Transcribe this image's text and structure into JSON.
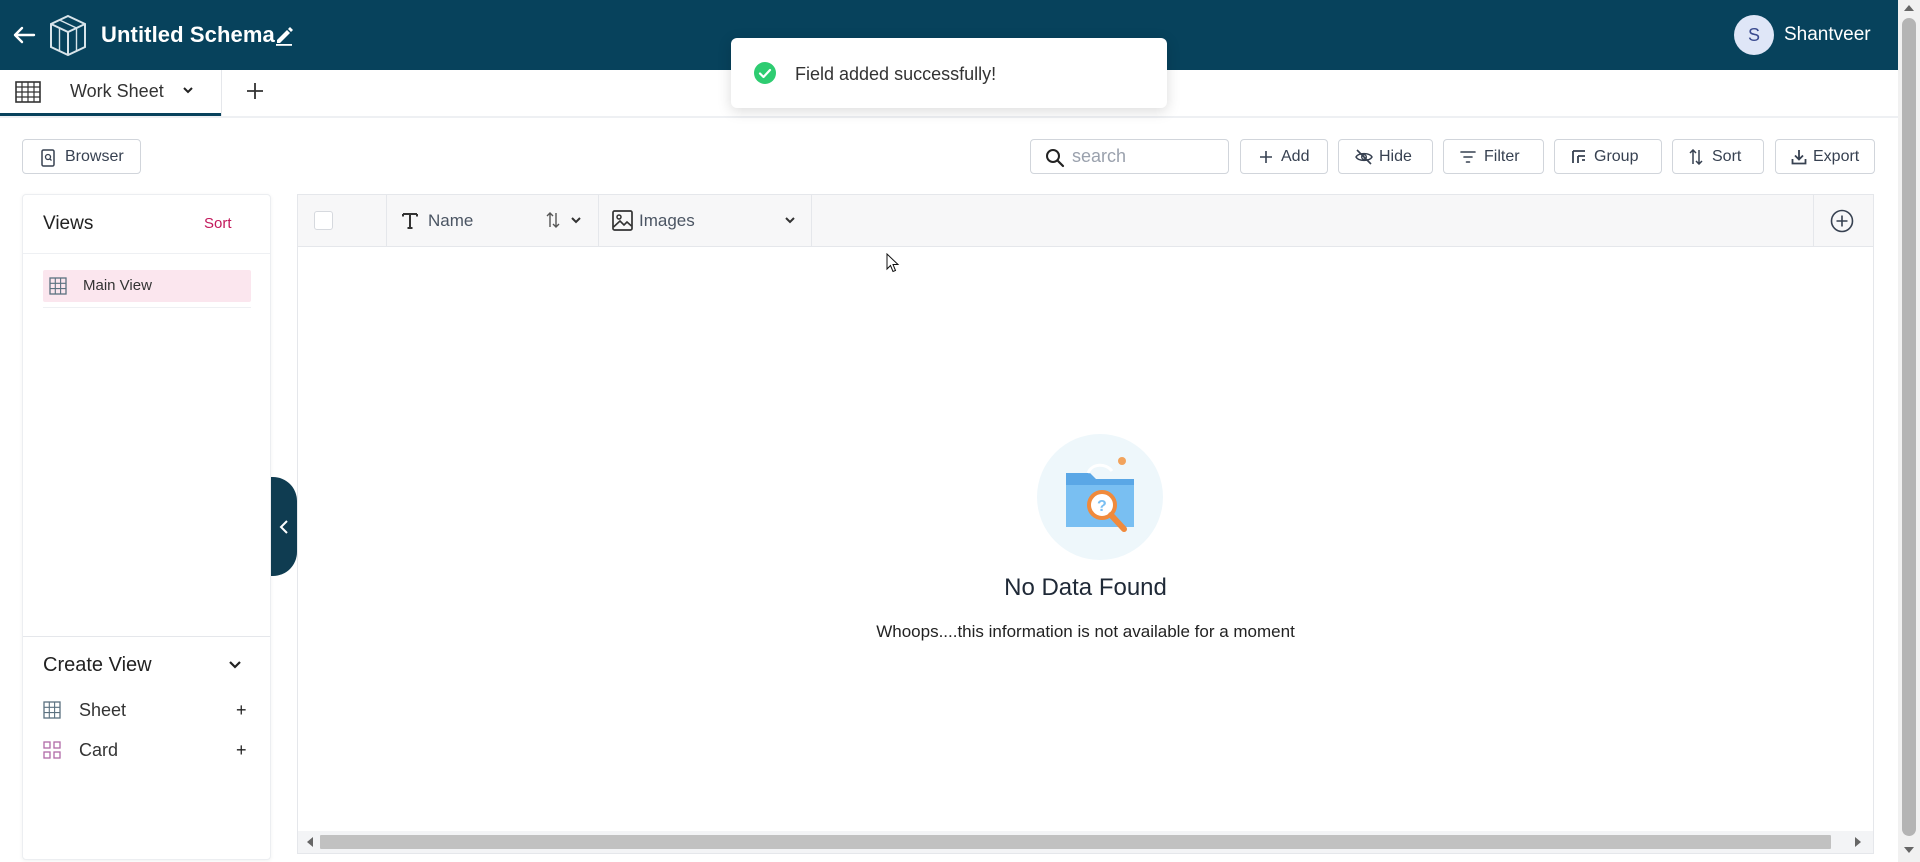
{
  "header": {
    "title": "Untitled Schema",
    "back_icon": "arrow-left-icon",
    "logo_icon": "cube-logo-icon",
    "edit_icon": "pencil-icon",
    "user": {
      "initial": "S",
      "name": "Shantveer"
    },
    "background": "#07425c"
  },
  "toast": {
    "message": "Field added successfully!",
    "icon": "check-circle-icon",
    "icon_color": "#2ecc71"
  },
  "tabs": [
    {
      "label": "Work Sheet",
      "icon": "table-icon",
      "active": true
    }
  ],
  "toolbar": {
    "browser_label": "Browser",
    "search_placeholder": "search",
    "search_value": "",
    "add_label": "Add",
    "hide_label": "Hide",
    "filter_label": "Filter",
    "group_label": "Group",
    "sort_label": "Sort",
    "export_label": "Export"
  },
  "views_panel": {
    "title": "Views",
    "sort_label": "Sort",
    "accent": "#c2185b",
    "items": [
      {
        "label": "Main View",
        "icon": "grid-icon",
        "active": true
      }
    ],
    "create": {
      "title": "Create View",
      "options": [
        {
          "label": "Sheet",
          "icon": "grid-icon",
          "action": "+"
        },
        {
          "label": "Card",
          "icon": "card-icon",
          "action": "+"
        }
      ]
    }
  },
  "grid": {
    "columns": [
      {
        "label": "Name",
        "type_icon": "text-type-icon"
      },
      {
        "label": "Images",
        "type_icon": "image-icon"
      }
    ],
    "rows": [],
    "empty_state": {
      "title": "No Data Found",
      "subtitle": "Whoops....this information is not available for a moment"
    }
  }
}
